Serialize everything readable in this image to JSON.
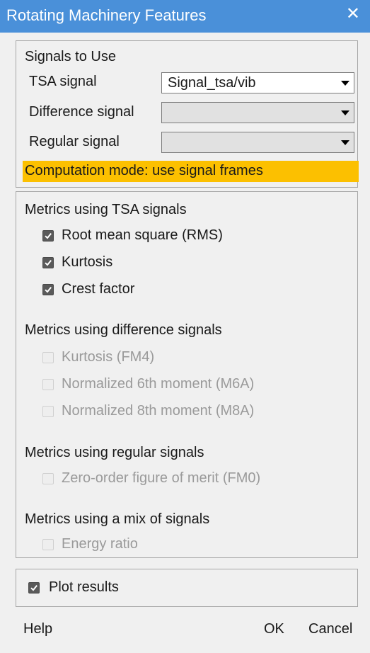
{
  "window": {
    "title": "Rotating Machinery Features",
    "close_glyph": "✕"
  },
  "signals": {
    "header": "Signals to Use",
    "tsa_label": "TSA signal",
    "tsa_value": "Signal_tsa/vib",
    "difference_label": "Difference signal",
    "difference_value": "",
    "regular_label": "Regular signal",
    "regular_value": "",
    "mode_banner": "Computation mode: use signal frames",
    "banner_color": "#fcc000"
  },
  "metrics": {
    "tsa_header": "Metrics using TSA signals",
    "tsa_items": [
      {
        "label": "Root mean square (RMS)",
        "checked": true,
        "enabled": true
      },
      {
        "label": "Kurtosis",
        "checked": true,
        "enabled": true
      },
      {
        "label": "Crest factor",
        "checked": true,
        "enabled": true
      }
    ],
    "difference_header": "Metrics using difference signals",
    "difference_items": [
      {
        "label": "Kurtosis (FM4)",
        "checked": false,
        "enabled": false
      },
      {
        "label": "Normalized 6th moment (M6A)",
        "checked": false,
        "enabled": false
      },
      {
        "label": "Normalized 8th moment (M8A)",
        "checked": false,
        "enabled": false
      }
    ],
    "regular_header": "Metrics using regular signals",
    "regular_items": [
      {
        "label": "Zero-order figure of merit (FM0)",
        "checked": false,
        "enabled": false
      }
    ],
    "mix_header": "Metrics using a mix of signals",
    "mix_items": [
      {
        "label": "Energy ratio",
        "checked": false,
        "enabled": false
      }
    ]
  },
  "plot": {
    "label": "Plot results",
    "checked": true
  },
  "footer": {
    "help": "Help",
    "ok": "OK",
    "cancel": "Cancel"
  },
  "colors": {
    "titlebar": "#4a90d9",
    "disabled_text": "#9a9a9a"
  }
}
